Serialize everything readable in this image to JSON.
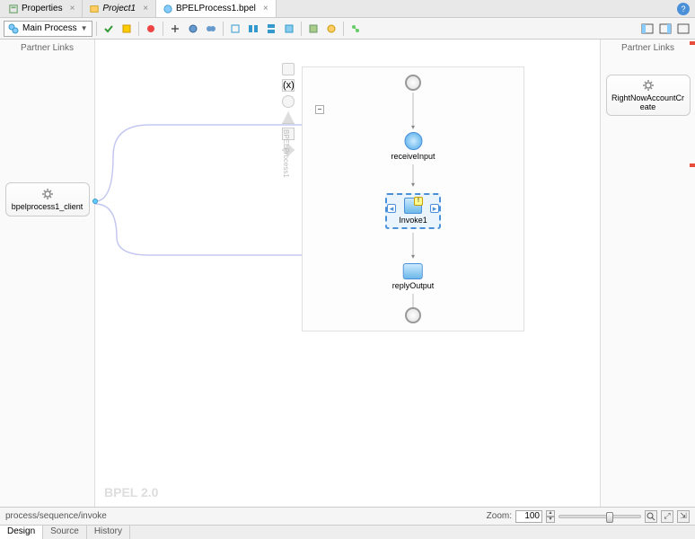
{
  "tabs": [
    {
      "label": "Properties",
      "icon": "properties-icon"
    },
    {
      "label": "Project1",
      "icon": "project-icon",
      "italic": true
    },
    {
      "label": "BPELProcess1.bpel",
      "icon": "bpel-icon",
      "active": true
    }
  ],
  "toolbar": {
    "dropdown_label": "Main Process"
  },
  "partner_links_header": "Partner Links",
  "left_partner": {
    "label": "bpelprocess1_client"
  },
  "right_partner": {
    "label": "RightNowAccountCreate"
  },
  "process": {
    "receive_label": "receiveInput",
    "invoke_label": "Invoke1",
    "reply_label": "replyOutput"
  },
  "watermark": "BPEL 2.0",
  "breadcrumb": "process/sequence/invoke",
  "zoom": {
    "label": "Zoom:",
    "value": "100"
  },
  "bottom_tabs": [
    "Design",
    "Source",
    "History"
  ]
}
